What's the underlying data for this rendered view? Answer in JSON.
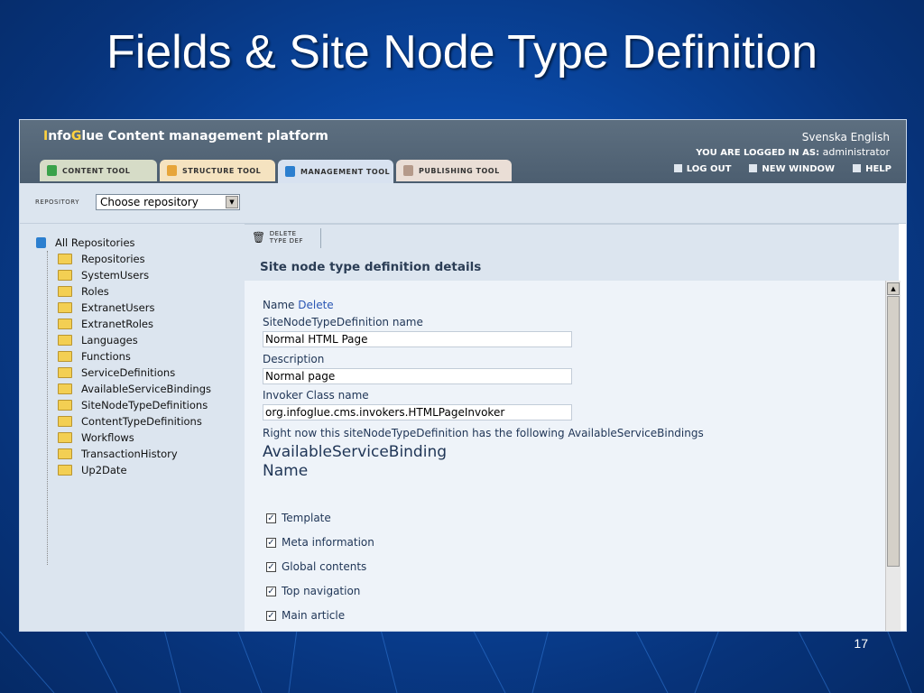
{
  "slide": {
    "title": "Fields & Site Node Type Definition",
    "number": "17"
  },
  "app": {
    "brand_prefix_1": "I",
    "brand_mid_1": "nfo",
    "brand_prefix_2": "G",
    "brand_rest": "lue Content management platform",
    "languages": "Svenska English",
    "logged_in_label": "YOU ARE LOGGED IN AS:",
    "logged_in_user": "administrator",
    "tabs": [
      "CONTENT TOOL",
      "STRUCTURE TOOL",
      "MANAGEMENT TOOL",
      "PUBLISHING TOOL"
    ],
    "actions": [
      "LOG OUT",
      "NEW WINDOW",
      "HELP"
    ]
  },
  "repository": {
    "label": "REPOSITORY",
    "selected": "Choose repository"
  },
  "tree": {
    "root": "All Repositories",
    "items": [
      "Repositories",
      "SystemUsers",
      "Roles",
      "ExtranetUsers",
      "ExtranetRoles",
      "Languages",
      "Functions",
      "ServiceDefinitions",
      "AvailableServiceBindings",
      "SiteNodeTypeDefinitions",
      "ContentTypeDefinitions",
      "Workflows",
      "TransactionHistory",
      "Up2Date"
    ]
  },
  "toolbar": {
    "delete_line1": "DELETE",
    "delete_line2": "TYPE DEF"
  },
  "details": {
    "section_title": "Site node type definition details",
    "name_label": "Name",
    "delete_link": "Delete",
    "sntd_name_label": "SiteNodeTypeDefinition name",
    "sntd_name_value": "Normal HTML Page",
    "description_label": "Description",
    "description_value": "Normal page",
    "invoker_label": "Invoker Class name",
    "invoker_value": "org.infoglue.cms.invokers.HTMLPageInvoker",
    "bindings_note": "Right now this siteNodeTypeDefinition has the following AvailableServiceBindings",
    "bindings_header_1": "AvailableServiceBinding",
    "bindings_header_2": "Name",
    "bindings": [
      {
        "label": "Template",
        "checked": true
      },
      {
        "label": "Meta information",
        "checked": true
      },
      {
        "label": "Global contents",
        "checked": true
      },
      {
        "label": "Top navigation",
        "checked": true
      },
      {
        "label": "Main article",
        "checked": true
      }
    ]
  },
  "colors": {
    "slide_bg": "#0a4aa8",
    "header_bg": "#56687a",
    "panel_bg": "#dce5ef",
    "detail_bg": "#eef3f9",
    "link": "#2a56b4",
    "brand_accent": "#ffd23f"
  }
}
